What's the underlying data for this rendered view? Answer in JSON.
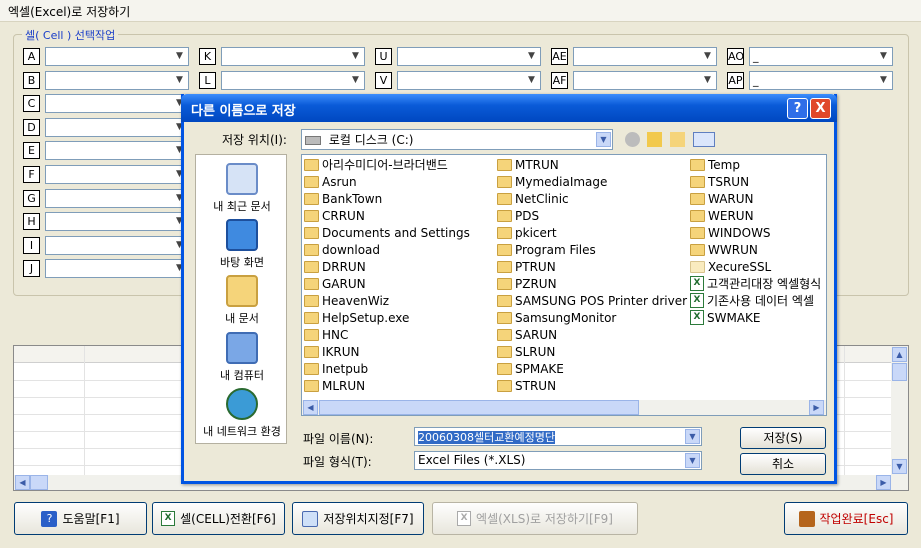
{
  "window": {
    "title": "엑셀(Excel)로 저장하기"
  },
  "group": {
    "label": "셀( Cell ) 선택작업"
  },
  "cell_rows": [
    {
      "col1": "A",
      "col2": "K",
      "col3": "U",
      "col4": "AE",
      "col5": "AO",
      "val5": "_"
    },
    {
      "col1": "B",
      "col2": "L",
      "col3": "V",
      "col4": "AF",
      "col5": "AP",
      "val5": "_"
    },
    {
      "col1": "C"
    },
    {
      "col1": "D"
    },
    {
      "col1": "E"
    },
    {
      "col1": "F"
    },
    {
      "col1": "G"
    },
    {
      "col1": "H"
    },
    {
      "col1": "I"
    },
    {
      "col1": "J"
    }
  ],
  "buttons": {
    "help": "도움말[F1]",
    "convert": "셀(CELL)전환[F6]",
    "location": "저장위치지정[F7]",
    "save_excel": "엑셀(XLS)로 저장하기[F9]",
    "finish": "작업완료[Esc]"
  },
  "dialog": {
    "title": "다른 이름으로 저장",
    "help_btn": "?",
    "close_btn": "X",
    "save_in_label": "저장 위치(I):",
    "save_in_value": "로컬 디스크 (C:)",
    "places": [
      "내 최근 문서",
      "바탕 화면",
      "내 문서",
      "내 컴퓨터",
      "내 네트워크 환경"
    ],
    "files_col1": [
      "아리수미디어-브라더밴드",
      "Asrun",
      "BankTown",
      "CRRUN",
      "Documents and Settings",
      "download",
      "DRRUN",
      "GARUN",
      "HeavenWiz",
      "HelpSetup.exe",
      "HNC",
      "IKRUN",
      "Inetpub",
      "MLRUN"
    ],
    "files_col2": [
      "MTRUN",
      "MymediaImage",
      "NetClinic",
      "PDS",
      "pkicert",
      "Program Files",
      "PTRUN",
      "PZRUN",
      "SAMSUNG POS Printer driver",
      "SamsungMonitor",
      "SARUN",
      "SLRUN",
      "SPMAKE",
      "STRUN"
    ],
    "files_col3": [
      "Temp",
      "TSRUN",
      "WARUN",
      "WERUN",
      "WINDOWS",
      "WWRUN",
      "XecureSSL",
      "고객관리대장 엑셀형식",
      "기존사용 데이터 엑셀",
      "SWMAKE"
    ],
    "filename_label": "파일 이름(N):",
    "filename_value": "20060308셀터교환예정명단",
    "filetype_label": "파일 형식(T):",
    "filetype_value": "Excel Files (*.XLS)",
    "save_btn": "저장(S)",
    "cancel_btn": "취소"
  },
  "colors": {
    "dialog_title": "#0a5bd8",
    "group_label": "#1a3ec8"
  }
}
